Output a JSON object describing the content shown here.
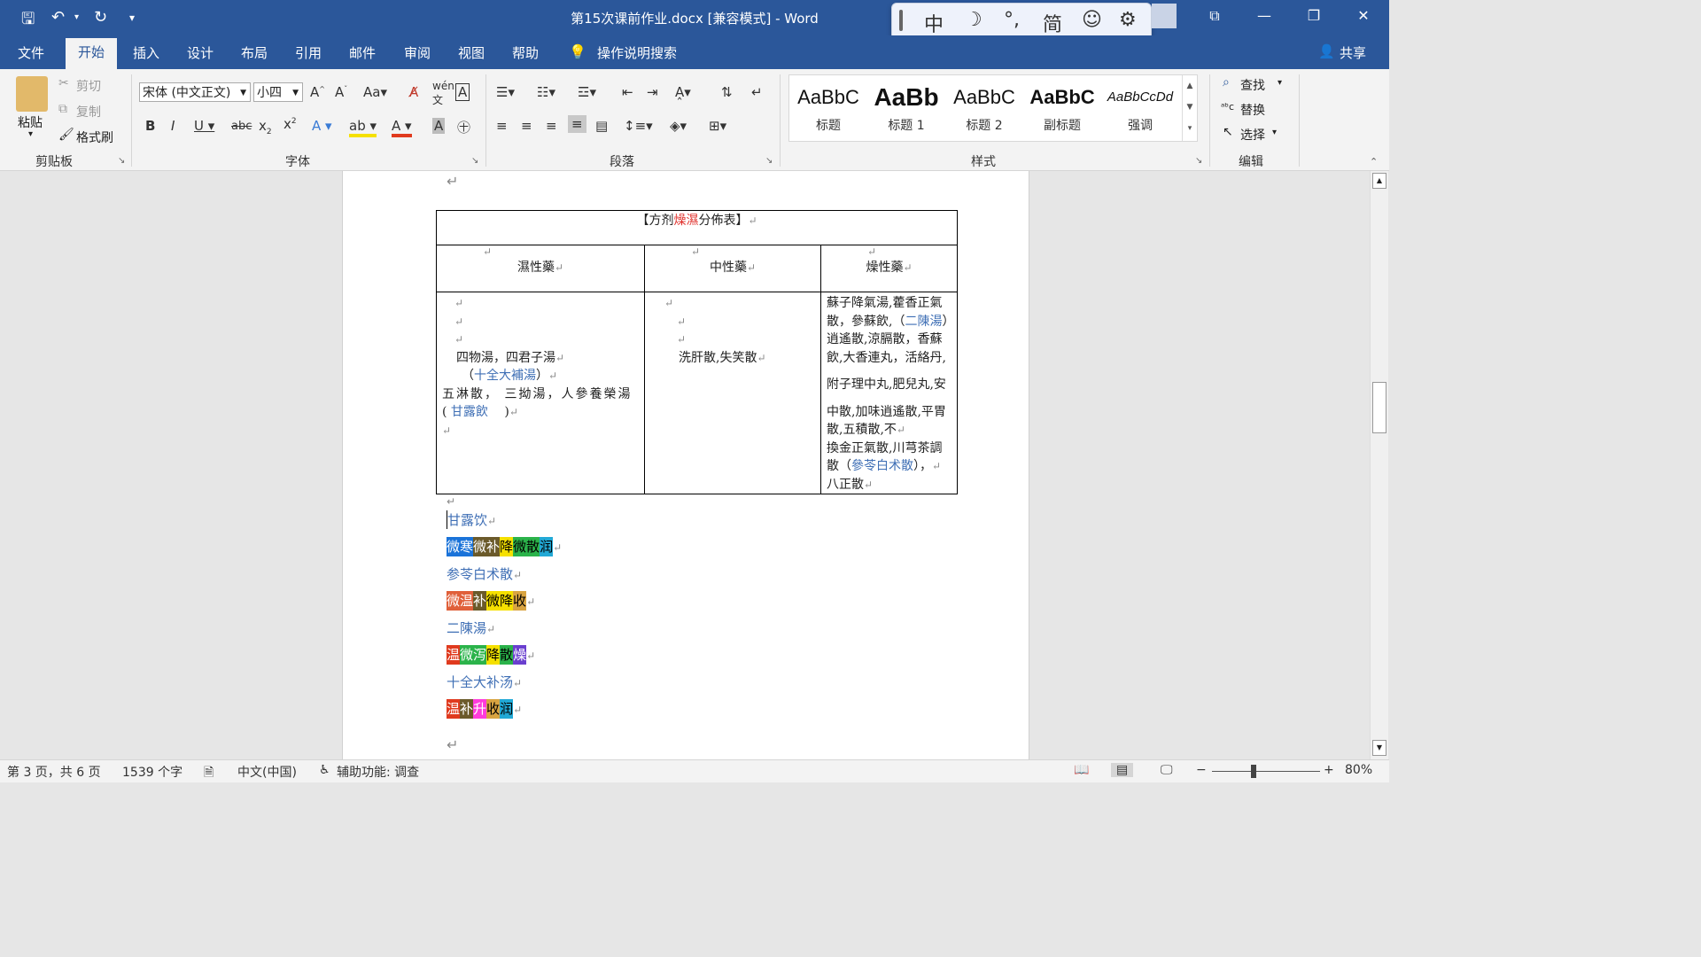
{
  "titlebar": {
    "doc_title": "第15次课前作业.docx [兼容模式] - Word",
    "quick_access": {
      "save": "🖫",
      "undo": "↶",
      "redo": "↻",
      "customize": "▾"
    },
    "ime_toolbar": [
      "中",
      "☽",
      "°,",
      "简",
      "☺",
      "⚙"
    ],
    "window": {
      "restore_ribbon": "⧉",
      "minimize": "—",
      "maximize": "❐",
      "close": "✕"
    }
  },
  "menu": {
    "tabs": [
      "文件",
      "开始",
      "插入",
      "设计",
      "布局",
      "引用",
      "邮件",
      "审阅",
      "视图",
      "帮助"
    ],
    "active": "开始",
    "tell_me": "操作说明搜索",
    "share": "共享"
  },
  "ribbon": {
    "clipboard": {
      "paste": "粘贴",
      "cut": "剪切",
      "copy": "复制",
      "format_painter": "格式刷",
      "group_label": "剪贴板"
    },
    "font": {
      "font_name": "宋体 (中文正文)",
      "font_size": "小四",
      "group_label": "字体"
    },
    "paragraph": {
      "group_label": "段落"
    },
    "styles": {
      "items": [
        {
          "sample": "AaBbC",
          "name": "标题"
        },
        {
          "sample": "AaBb",
          "name": "标题 1"
        },
        {
          "sample": "AaBbC",
          "name": "标题 2"
        },
        {
          "sample": "AaBbC",
          "name": "副标题"
        },
        {
          "sample": "AaBbCcDd",
          "name": "强调"
        }
      ],
      "group_label": "样式"
    },
    "editing": {
      "find": "查找",
      "replace": "替换",
      "select": "选择",
      "group_label": "编辑"
    }
  },
  "document": {
    "table_title_prefix": "【方剂",
    "table_title_highlight": "燥濕",
    "table_title_suffix": "分佈表】",
    "headers": [
      "濕性藥",
      "中性藥",
      "燥性藥"
    ],
    "col1": {
      "line1": "四物湯，四君子湯",
      "line2_open": "（",
      "line2_blue": "十全大補湯",
      "line2_close": "）",
      "line3": "五淋散， 三拗湯，人參養榮湯",
      "line4_open": "( ",
      "line4_blue": "甘露飲",
      "line4_close": " )"
    },
    "col2": {
      "line1": "洗肝散,失笑散"
    },
    "col3": {
      "p1_a": "蘇子降氣湯,藿香正氣散，參蘇飲,（",
      "p1_blue": "二陳湯",
      "p1_b": "）逍遙散,涼膈散，香蘇飲,大香連丸，活絡丹,",
      "p2": "附子理中丸,肥兒丸,安",
      "p3": "中散,加味逍遙散,平胃散,五積散,不",
      "p4_a": "換金正氣散,川芎茶調散（",
      "p4_blue": "參苓白术散",
      "p4_b": "），",
      "p5": "八正散"
    },
    "below": [
      {
        "title": "甘露饮",
        "tags": [
          {
            "t": "微寒",
            "bg": "#1a73d9",
            "fg": "#ffffff"
          },
          {
            "t": "微补",
            "bg": "#6b5a2a",
            "fg": "#ffffff"
          },
          {
            "t": "降",
            "bg": "#f5e000",
            "fg": "#000000"
          },
          {
            "t": "微散",
            "bg": "#2bb34a",
            "fg": "#000000"
          },
          {
            "t": "润",
            "bg": "#22a9d6",
            "fg": "#000000"
          }
        ]
      },
      {
        "title": "参苓白术散",
        "tags": [
          {
            "t": "微温",
            "bg": "#e0603a",
            "fg": "#ffffff"
          },
          {
            "t": "补",
            "bg": "#6b5a2a",
            "fg": "#ffffff"
          },
          {
            "t": "微降",
            "bg": "#f5e000",
            "fg": "#000000"
          },
          {
            "t": "收",
            "bg": "#d9a441",
            "fg": "#000000"
          }
        ]
      },
      {
        "title": "二陳湯",
        "tags": [
          {
            "t": "温",
            "bg": "#e03a1e",
            "fg": "#ffffff"
          },
          {
            "t": "微泻",
            "bg": "#2bb34a",
            "fg": "#ffffff"
          },
          {
            "t": "降",
            "bg": "#f5e000",
            "fg": "#000000"
          },
          {
            "t": "散",
            "bg": "#2bb34a",
            "fg": "#000000"
          },
          {
            "t": "燥",
            "bg": "#6a3fcf",
            "fg": "#ffffff"
          }
        ]
      },
      {
        "title": "十全大补汤",
        "tags": [
          {
            "t": "温",
            "bg": "#e03a1e",
            "fg": "#ffffff"
          },
          {
            "t": "补",
            "bg": "#6b5a2a",
            "fg": "#ffffff"
          },
          {
            "t": "升",
            "bg": "#ff3cdc",
            "fg": "#ffffff"
          },
          {
            "t": "收",
            "bg": "#d9a441",
            "fg": "#000000"
          },
          {
            "t": "润",
            "bg": "#22a9d6",
            "fg": "#000000"
          }
        ]
      }
    ]
  },
  "statusbar": {
    "page": "第 3 页，共 6 页",
    "words": "1539 个字",
    "language": "中文(中国)",
    "accessibility": "辅助功能: 调查",
    "zoom": "80%"
  }
}
